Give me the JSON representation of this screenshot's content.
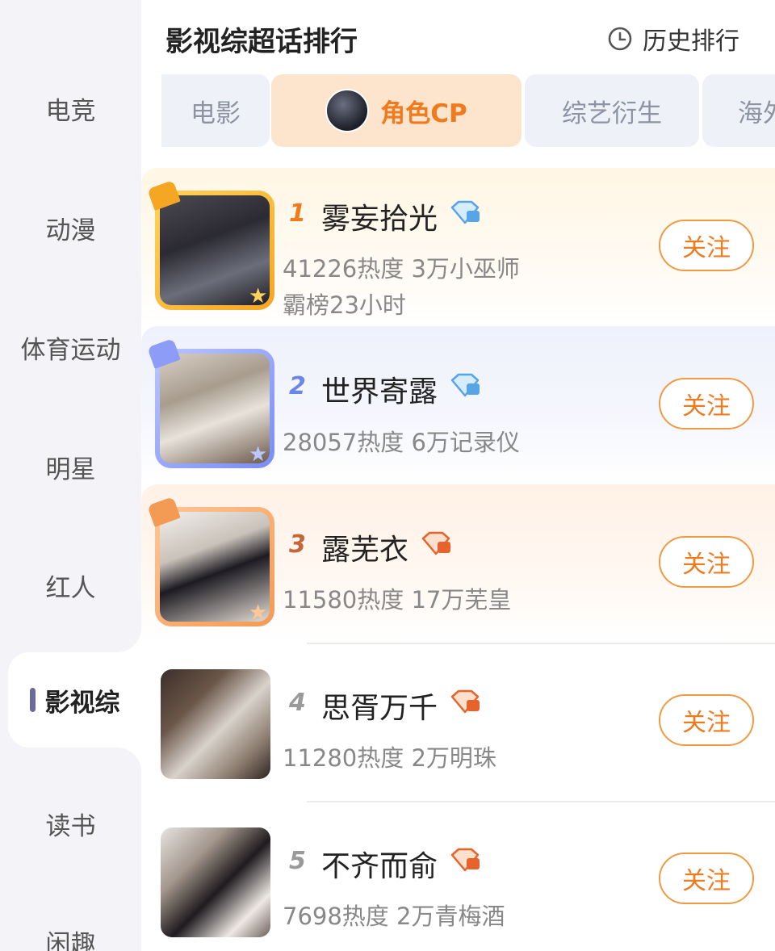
{
  "header": {
    "title": "影视综超话排行",
    "history_label": "历史排行"
  },
  "sidebar": {
    "items": [
      {
        "label": "电竞"
      },
      {
        "label": "动漫"
      },
      {
        "label": "体育运动"
      },
      {
        "label": "明星"
      },
      {
        "label": "红人"
      },
      {
        "label": "影视综",
        "active": true
      },
      {
        "label": "读书"
      },
      {
        "label": "闲趣"
      }
    ]
  },
  "tabs": [
    {
      "label": "电影"
    },
    {
      "label": "角色CP",
      "active": true
    },
    {
      "label": "综艺衍生"
    },
    {
      "label": "海外"
    }
  ],
  "list": [
    {
      "rank": "1",
      "name": "雾妄拾光",
      "heat": "41226热度 3万小巫师",
      "extra": "霸榜23小时",
      "follow": "关注"
    },
    {
      "rank": "2",
      "name": "世界寄露",
      "heat": "28057热度 6万记录仪",
      "follow": "关注"
    },
    {
      "rank": "3",
      "name": "露芜衣",
      "heat": "11580热度 17万芜皇",
      "follow": "关注"
    },
    {
      "rank": "4",
      "name": "思胥万千",
      "heat": "11280热度 2万明珠",
      "follow": "关注"
    },
    {
      "rank": "5",
      "name": "不齐而俞",
      "heat": "7698热度 2万青梅酒",
      "follow": "关注"
    }
  ],
  "colors": {
    "accent": "#f07a1e",
    "tab_active_bg": "#fde4cc",
    "sidebar_bg": "#f4f4f8"
  }
}
